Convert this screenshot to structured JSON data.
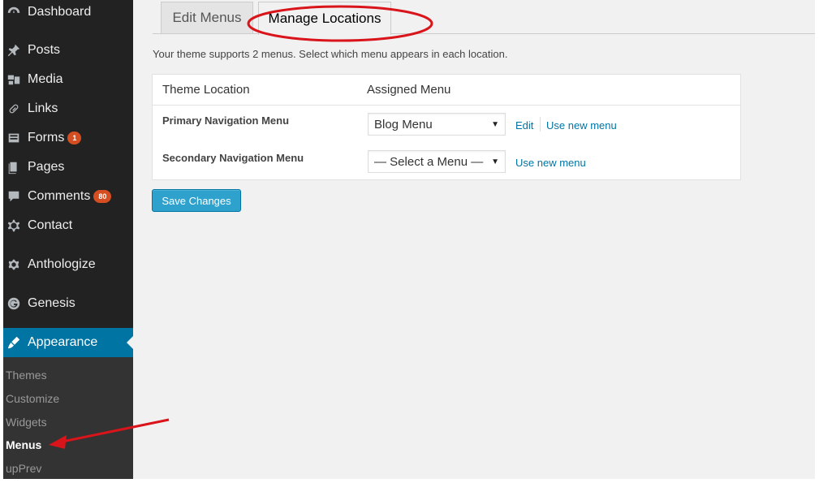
{
  "sidebar": {
    "items": [
      {
        "label": "Dashboard",
        "icon": "dashboard-icon"
      },
      {
        "label": "Posts",
        "icon": "pin-icon"
      },
      {
        "label": "Media",
        "icon": "media-icon"
      },
      {
        "label": "Links",
        "icon": "link-icon"
      },
      {
        "label": "Forms",
        "icon": "forms-icon",
        "badge": "1"
      },
      {
        "label": "Pages",
        "icon": "pages-icon"
      },
      {
        "label": "Comments",
        "icon": "comment-icon",
        "badge": "80"
      },
      {
        "label": "Contact",
        "icon": "gear-icon"
      },
      {
        "label": "Anthologize",
        "icon": "gear-icon"
      },
      {
        "label": "Genesis",
        "icon": "genesis-icon"
      }
    ],
    "active": {
      "label": "Appearance",
      "icon": "brush-icon"
    },
    "submenu": [
      "Themes",
      "Customize",
      "Widgets",
      "Menus",
      "upPrev"
    ]
  },
  "tabs": {
    "edit": "Edit Menus",
    "manage": "Manage Locations"
  },
  "description": "Your theme supports 2 menus. Select which menu appears in each location.",
  "table": {
    "col_location": "Theme Location",
    "col_menu": "Assigned Menu",
    "rows": [
      {
        "location": "Primary Navigation Menu",
        "selected": "Blog Menu",
        "edit_link": "Edit",
        "new_link": "Use new menu"
      },
      {
        "location": "Secondary Navigation Menu",
        "selected": "— Select a Menu —",
        "new_link": "Use new menu"
      }
    ]
  },
  "save_label": "Save Changes",
  "colors": {
    "accent": "#0074a2",
    "button": "#2ea2cc",
    "annotation": "#d9141a",
    "badge": "#d54e21"
  }
}
